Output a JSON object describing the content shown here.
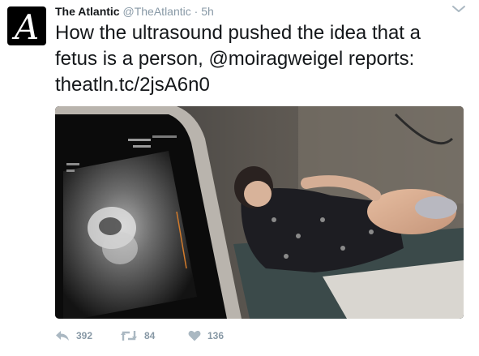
{
  "tweet": {
    "author_name": "The Atlantic",
    "handle": "@TheAtlantic",
    "separator": "·",
    "time": "5h",
    "avatar_letter": "A",
    "text_line1": "How the ultrasound pushed the idea that a",
    "text_line2_pre": "fetus is a person, ",
    "mention": "@moiragweigel",
    "text_line2_post": " reports:",
    "link": "theatln.tc/2jsA6n0",
    "replies": "392",
    "retweets": "84",
    "likes": "136"
  },
  "icons": {
    "menu": "chevron-down-icon",
    "reply": "reply-icon",
    "retweet": "retweet-icon",
    "like": "heart-icon"
  },
  "colors": {
    "text": "#14171a",
    "muted": "#8899a6",
    "avatar_bg": "#000000"
  }
}
